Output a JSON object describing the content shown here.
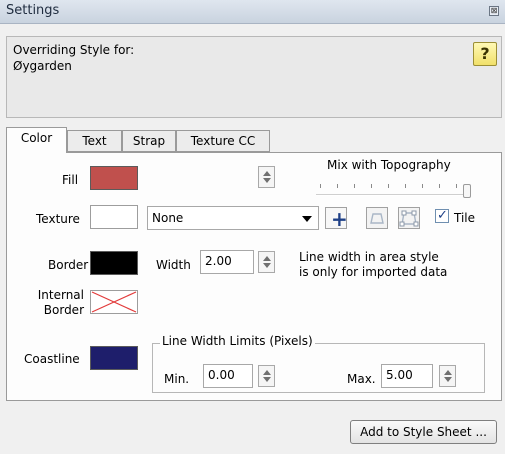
{
  "window": {
    "title": "Settings",
    "close_glyph": "⊠"
  },
  "info": {
    "line1": "Overriding Style for:",
    "line2": "Øygarden",
    "help_glyph": "?",
    "help_icon": "help-question-icon"
  },
  "tabs": [
    {
      "label": "Color",
      "active": true
    },
    {
      "label": "Text",
      "active": false
    },
    {
      "label": "Strap",
      "active": false
    },
    {
      "label": "Texture CC",
      "active": false
    }
  ],
  "color_tab": {
    "fill": {
      "label": "Fill",
      "color": "#c0504d"
    },
    "mix": {
      "label": "Mix with Topography",
      "value_fraction": 1.0
    },
    "texture": {
      "label": "Texture",
      "color": "#ffffff",
      "dropdown_value": "None",
      "tile_label": "Tile",
      "tile_checked": true,
      "add_icon": "plus-icon",
      "shape_icon1": "polygon-outline-icon",
      "shape_icon2": "polygon-corners-icon"
    },
    "border": {
      "label": "Border",
      "color": "#000000",
      "width_label": "Width",
      "width_value": "2.00",
      "note_line1": "Line width in area style",
      "note_line2": "is only for imported data"
    },
    "internal_border": {
      "label_line1": "Internal",
      "label_line2": "Border",
      "icon": "no-color-icon"
    },
    "coastline": {
      "label": "Coastline",
      "color": "#1e1e6b"
    },
    "limits": {
      "title": "Line Width Limits (Pixels)",
      "min_label": "Min.",
      "min_value": "0.00",
      "max_label": "Max.",
      "max_value": "5.00"
    }
  },
  "footer": {
    "add_button": "Add to Style Sheet ..."
  }
}
